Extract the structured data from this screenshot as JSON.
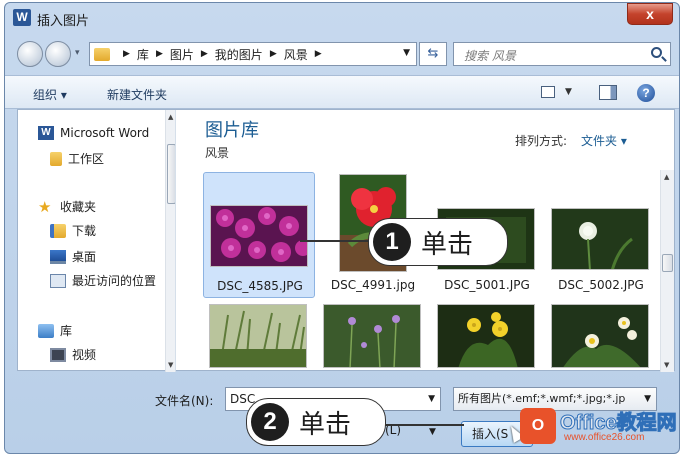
{
  "window": {
    "title": "插入图片",
    "app_icon": "W",
    "close_label": "x"
  },
  "address": {
    "breadcrumb": [
      "库",
      "图片",
      "我的图片",
      "风景"
    ],
    "search_placeholder": "搜索 风景"
  },
  "toolbar": {
    "organize": "组织 ▾",
    "new_folder": "新建文件夹",
    "help": "?"
  },
  "sidebar": {
    "items": [
      {
        "label": "Microsoft Word",
        "icon": "word-icon"
      },
      {
        "label": "工作区",
        "icon": "folder-icon"
      },
      {
        "label": "收藏夹",
        "icon": "star-icon"
      },
      {
        "label": "下载",
        "icon": "downloads-icon"
      },
      {
        "label": "桌面",
        "icon": "desktop-icon"
      },
      {
        "label": "最近访问的位置",
        "icon": "recent-places-icon"
      },
      {
        "label": "库",
        "icon": "library-icon"
      },
      {
        "label": "视频",
        "icon": "video-icon"
      }
    ]
  },
  "library": {
    "title": "图片库",
    "subtitle": "风景",
    "arrange_label": "排列方式:",
    "arrange_value": "文件夹 ▾"
  },
  "files": [
    {
      "name": "DSC_4585.JPG",
      "selected": true
    },
    {
      "name": "DSC_4991.jpg",
      "selected": false
    },
    {
      "name": "DSC_5001.JPG",
      "selected": false
    },
    {
      "name": "DSC_5002.JPG",
      "selected": false
    },
    {
      "name": "",
      "selected": false
    },
    {
      "name": "",
      "selected": false
    },
    {
      "name": "",
      "selected": false
    },
    {
      "name": "",
      "selected": false
    }
  ],
  "bottom": {
    "filename_label": "文件名(N):",
    "filename_value": "DSC",
    "filetype_value": "所有图片(*.emf;*.wmf;*.jpg;*.jp",
    "tools_label": "(L)",
    "insert_label": "插入(S"
  },
  "annotations": [
    {
      "number": "1",
      "text": "单击"
    },
    {
      "number": "2",
      "text": "单击"
    }
  ],
  "watermark": {
    "logo": "O",
    "text": "Office教程网",
    "sub": "www.office26.com"
  }
}
